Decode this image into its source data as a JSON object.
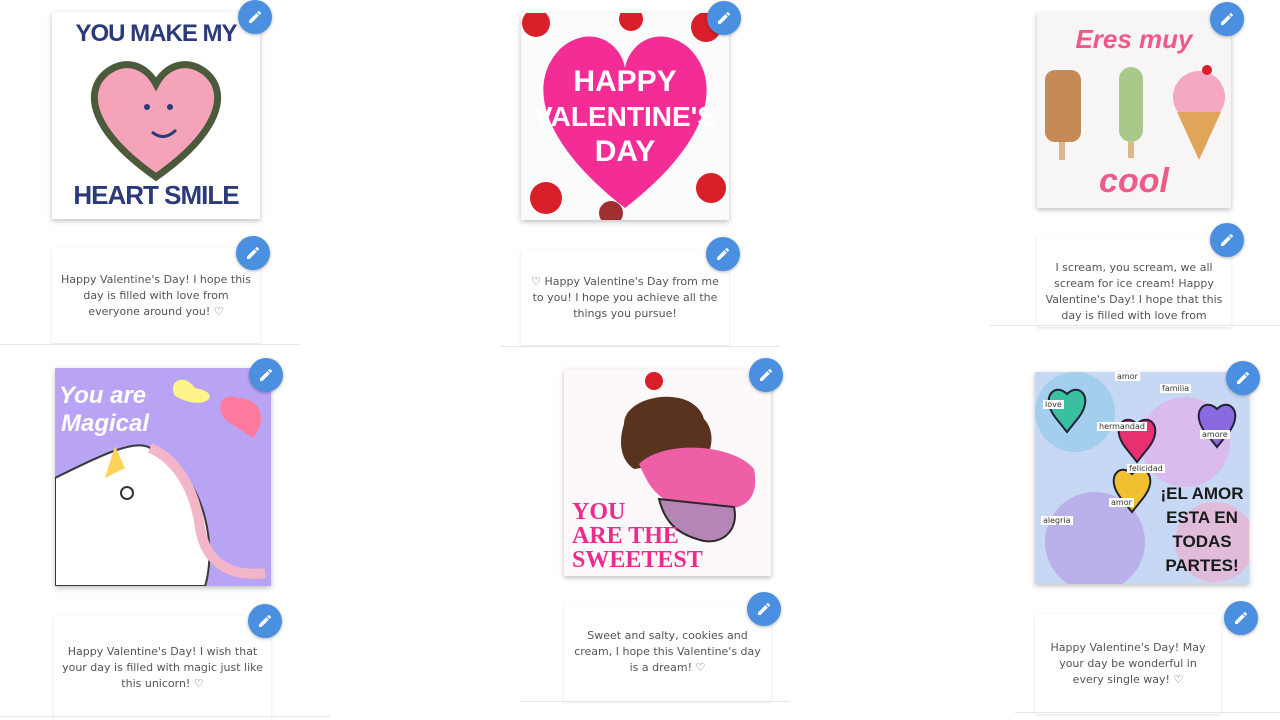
{
  "cards": [
    {
      "id": "heart-smile",
      "art_text": [
        "YOU MAKE MY",
        "HEART SMILE"
      ],
      "message": "Happy Valentine's Day! I hope this day is filled with love from everyone around you! ♡"
    },
    {
      "id": "happy-valentines",
      "art_text": [
        "HAPPY",
        "VALENTINE'S",
        "DAY"
      ],
      "message": "♡ Happy Valentine's Day from me to you! I hope you achieve all the things you pursue!"
    },
    {
      "id": "eres-muy-cool",
      "art_text": [
        "Eres muy",
        "cool"
      ],
      "message": "I scream, you scream, we all scream for ice cream! Happy Valentine's Day! I hope that this day is filled with love from"
    },
    {
      "id": "you-are-magical",
      "art_text": [
        "You are",
        "Magical"
      ],
      "message": "Happy Valentine's Day! I wish that your day is filled with magic just like this unicorn! ♡"
    },
    {
      "id": "you-are-the-sweetest",
      "art_text": [
        "YOU",
        "ARE THE",
        "SWEETEST"
      ],
      "message": "Sweet and salty, cookies and cream, I hope this Valentine's day is a dream! ♡"
    },
    {
      "id": "el-amor",
      "art_text": [
        "¡EL AMOR",
        "ESTA EN",
        "TODAS",
        "PARTES!"
      ],
      "art_labels": [
        "amor",
        "familia",
        "love",
        "hermandad",
        "amore",
        "felicidad",
        "amor",
        "alegria"
      ],
      "message": "Happy Valentine's Day! May your day be wonderful in every single way! ♡"
    }
  ],
  "colors": {
    "edit_button": "#4a8fe0",
    "message_text": "#555555"
  },
  "icons": {
    "edit": "pencil-icon"
  }
}
